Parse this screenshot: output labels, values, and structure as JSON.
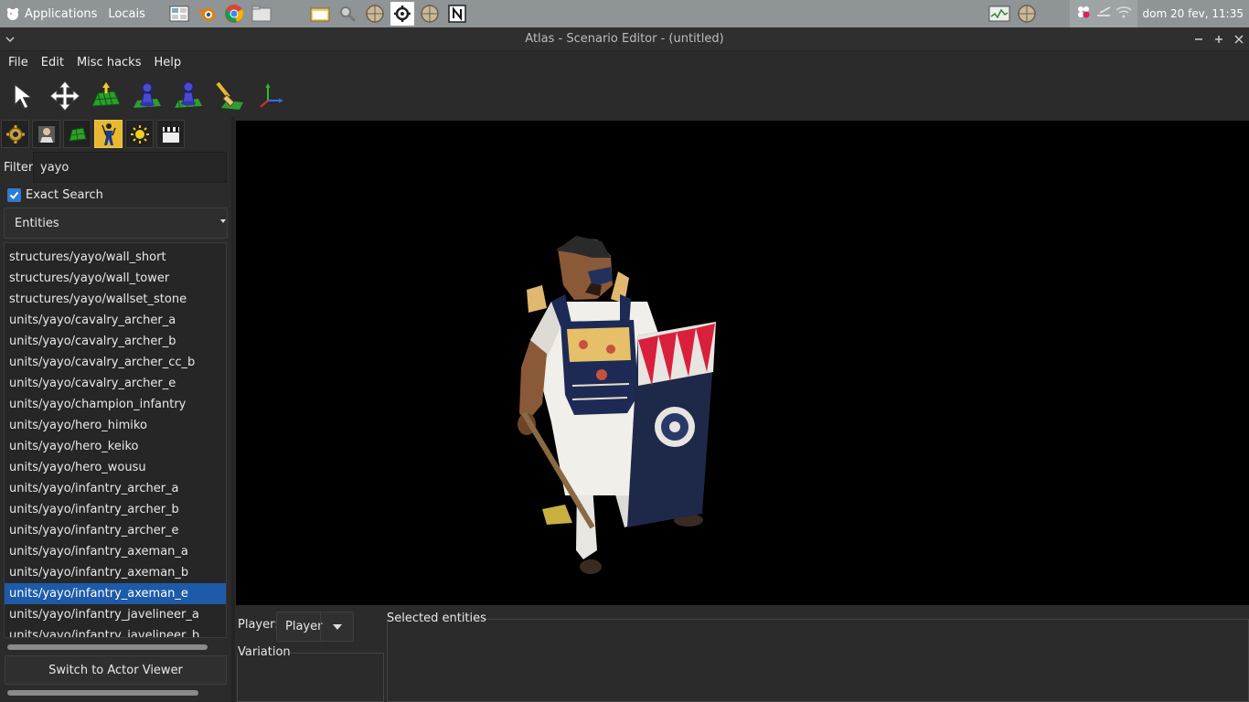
{
  "system_panel": {
    "applications_label": "Applications",
    "places_label": "Locais",
    "clock": "dom 20 fev, 11:35"
  },
  "window": {
    "title": "Atlas - Scenario Editor - (untitled)"
  },
  "menubar": {
    "items": [
      "File",
      "Edit",
      "Misc hacks",
      "Help"
    ]
  },
  "toolbar": {
    "tools": [
      "select-tool",
      "move-tool",
      "terrain-elevation-tool",
      "place-unit-tool",
      "place-object-tool",
      "paint-terrain-tool",
      "axes-tool"
    ]
  },
  "left_panel": {
    "tabs": [
      "map-tab",
      "player-tab",
      "terrain-tab",
      "object-tab",
      "environment-tab",
      "cinema-tab"
    ],
    "active_tab": "object-tab",
    "filter_label": "Filter",
    "filter_value": "yayo",
    "exact_search_label": "Exact Search",
    "exact_search_checked": true,
    "type_combo_value": "Entities",
    "items": [
      "structures/yayo/wall_short",
      "structures/yayo/wall_tower",
      "structures/yayo/wallset_stone",
      "units/yayo/cavalry_archer_a",
      "units/yayo/cavalry_archer_b",
      "units/yayo/cavalry_archer_cc_b",
      "units/yayo/cavalry_archer_e",
      "units/yayo/champion_infantry",
      "units/yayo/hero_himiko",
      "units/yayo/hero_keiko",
      "units/yayo/hero_wousu",
      "units/yayo/infantry_archer_a",
      "units/yayo/infantry_archer_b",
      "units/yayo/infantry_archer_e",
      "units/yayo/infantry_axeman_a",
      "units/yayo/infantry_axeman_b",
      "units/yayo/infantry_axeman_e",
      "units/yayo/infantry_javelineer_a",
      "units/yayo/infantry_javelineer_b"
    ],
    "selected_item": "units/yayo/infantry_axeman_e",
    "switch_button_label": "Switch to Actor Viewer"
  },
  "bottom_panel": {
    "player_label": "Player:",
    "player_value": "Player",
    "variation_label": "Variation",
    "selected_entities_label": "Selected entities"
  },
  "colors": {
    "selection": "#1d5aa8",
    "active_tab": "#e8b830",
    "checkbox": "#2d7ad6"
  }
}
